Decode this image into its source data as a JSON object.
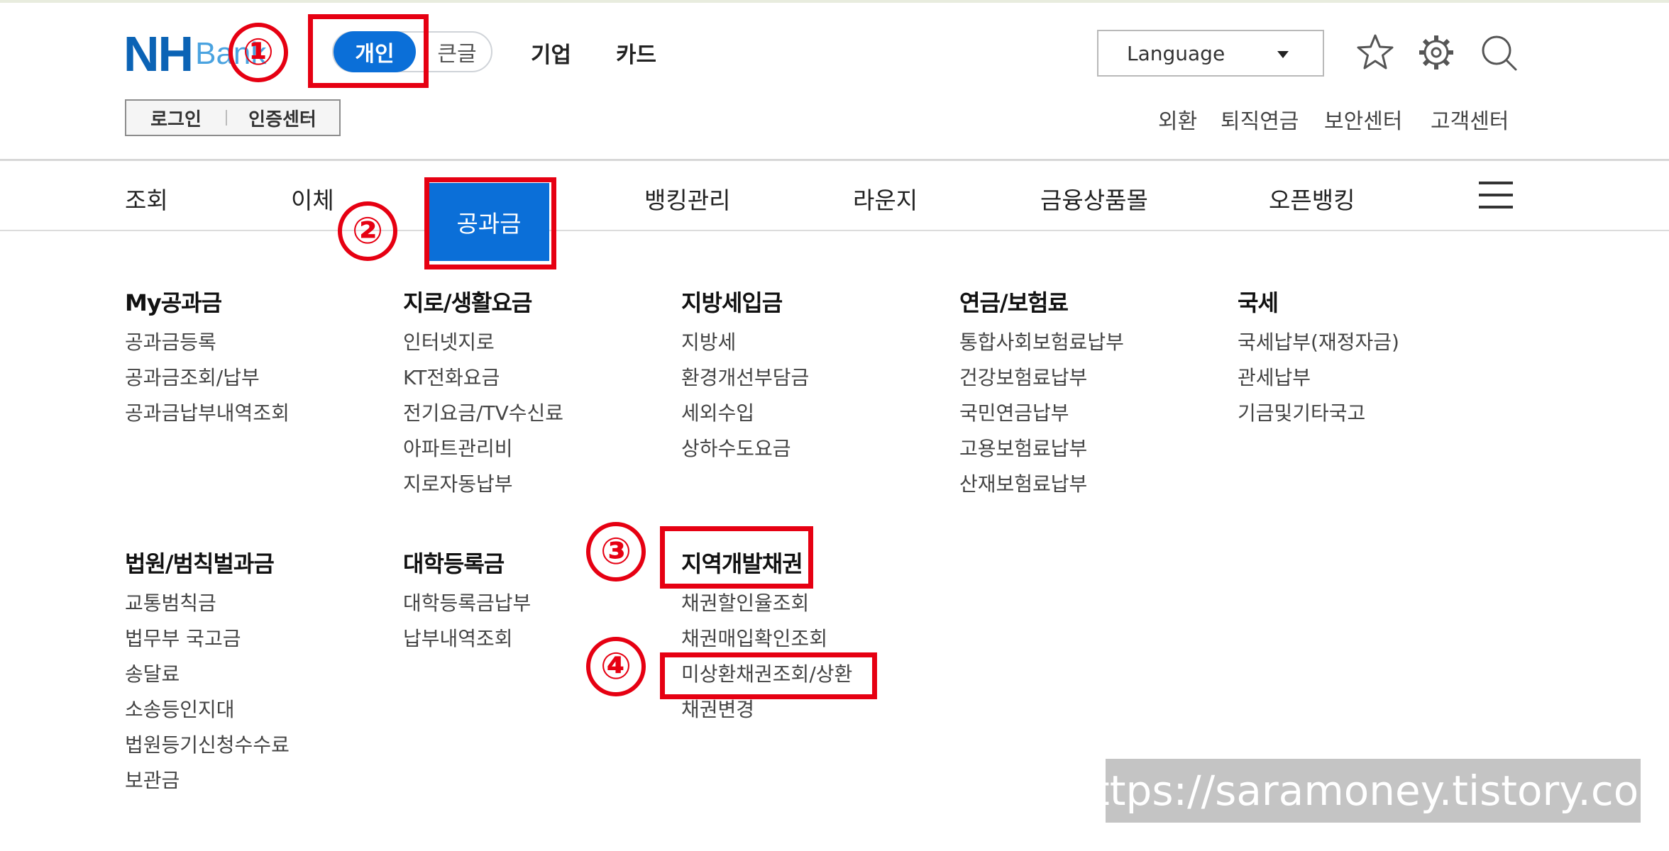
{
  "header": {
    "logo_main": "NH",
    "logo_sub": "Bank",
    "segment": {
      "personal": "개인",
      "large_text": "큰글"
    },
    "nav": {
      "business": "기업",
      "card": "카드"
    },
    "login": "로그인",
    "cert_center": "인증센터",
    "language": "Language",
    "utility_links": {
      "fx": "외환",
      "pension": "퇴직연금",
      "security": "보안센터",
      "customer": "고객센터"
    }
  },
  "gnb": {
    "items": [
      "조회",
      "이체",
      "공과금",
      "뱅킹관리",
      "라운지",
      "금융상품몰",
      "오픈뱅킹"
    ]
  },
  "menu": {
    "row1": [
      {
        "title": "My공과금",
        "items": [
          "공과금등록",
          "공과금조회/납부",
          "공과금납부내역조회"
        ]
      },
      {
        "title": "지로/생활요금",
        "items": [
          "인터넷지로",
          "KT전화요금",
          "전기요금/TV수신료",
          "아파트관리비",
          "지로자동납부"
        ]
      },
      {
        "title": "지방세입금",
        "items": [
          "지방세",
          "환경개선부담금",
          "세외수입",
          "상하수도요금"
        ]
      },
      {
        "title": "연금/보험료",
        "items": [
          "통합사회보험료납부",
          "건강보험료납부",
          "국민연금납부",
          "고용보험료납부",
          "산재보험료납부"
        ]
      },
      {
        "title": "국세",
        "items": [
          "국세납부(재정자금)",
          "관세납부",
          "기금및기타국고"
        ]
      }
    ],
    "row2": [
      {
        "title": "법원/범칙벌과금",
        "items": [
          "교통범칙금",
          "법무부 국고금",
          "송달료",
          "소송등인지대",
          "법원등기신청수수료",
          "보관금"
        ]
      },
      {
        "title": "대학등록금",
        "items": [
          "대학등록금납부",
          "납부내역조회"
        ]
      },
      {
        "title": "지역개발채권",
        "items": [
          "채권할인율조회",
          "채권매입확인조회",
          "미상환채권조회/상환",
          "채권변경"
        ]
      }
    ]
  },
  "annotations": {
    "m1": "①",
    "m2": "②",
    "m3": "③",
    "m4": "④"
  },
  "watermark": "https://saramoney.tistory.com",
  "colors": {
    "brand_blue": "#0b6fd8",
    "annotation_red": "#e60012"
  }
}
